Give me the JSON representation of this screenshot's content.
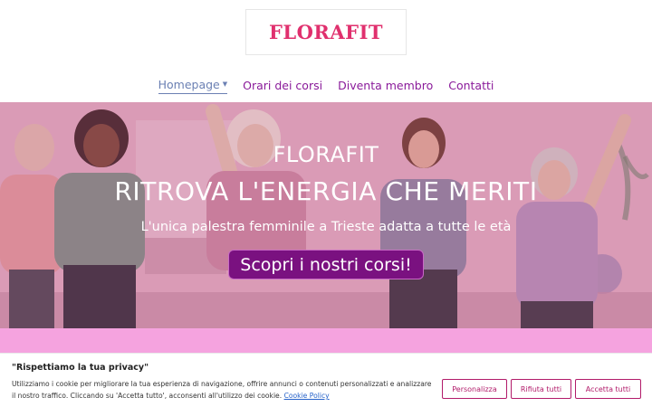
{
  "header": {
    "logo_text": "FLORAFIT"
  },
  "nav": {
    "items": [
      {
        "label": "Homepage",
        "active": true,
        "has_dropdown": true
      },
      {
        "label": "Orari dei corsi"
      },
      {
        "label": "Diventa membro"
      },
      {
        "label": "Contatti"
      }
    ]
  },
  "hero": {
    "subtitle": "FLORAFIT",
    "title": "RITROVA L'ENERGIA CHE MERITI",
    "tagline": "L'unica palestra femminile a Trieste adatta a tutte le età",
    "cta_label": "Scopri i nostri corsi!"
  },
  "cookie_banner": {
    "title": "\"Rispettiamo la tua privacy\"",
    "text": "Utilizziamo i cookie per migliorare la tua esperienza di navigazione, offrire annunci o contenuti personalizzati e analizzare il nostro traffico. Cliccando su 'Accetta tutto', acconsenti all'utilizzo dei cookie.",
    "policy_link": "Cookie Policy",
    "buttons": {
      "customize": "Personalizza",
      "reject": "Rifiuta tutti",
      "accept": "Accetta tutti"
    }
  },
  "colors": {
    "brand_pink": "#e0306e",
    "nav_purple": "#8a1a9a",
    "cta_purple": "#7a1180",
    "band_pink": "#f5a3df",
    "cookie_accent": "#b21b6a"
  }
}
